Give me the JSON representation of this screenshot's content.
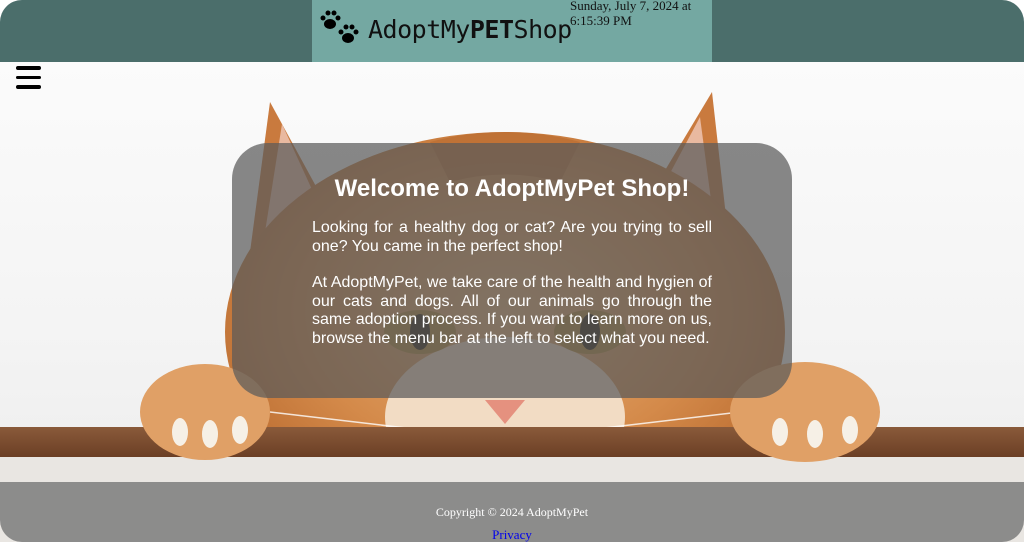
{
  "header": {
    "brand_prefix": "AdoptMy",
    "brand_bold": "PET",
    "brand_suffix": "Shop",
    "datetime": "Sunday, July 7, 2024 at 6:15:39 PM",
    "logo_icon": "paw-prints-icon",
    "colors": {
      "bar": "#4b6e6b",
      "brand_block": "#74a8a2"
    }
  },
  "nav": {
    "menu_icon": "hamburger-menu-icon"
  },
  "welcome": {
    "title": "Welcome to AdoptMyPet Shop!",
    "paragraph1": "Looking for a healthy dog or cat? Are you trying to sell one? You came in the perfect shop!",
    "paragraph2": "At AdoptMyPet, we take care of the health and hygien of our cats and dogs. All of our animals go through the same adoption process. If you want to learn more on us, browse the menu bar at the left to select what you need."
  },
  "footer": {
    "copyright": "Copyright © 2024 AdoptMyPet",
    "privacy_link": "Privacy"
  }
}
